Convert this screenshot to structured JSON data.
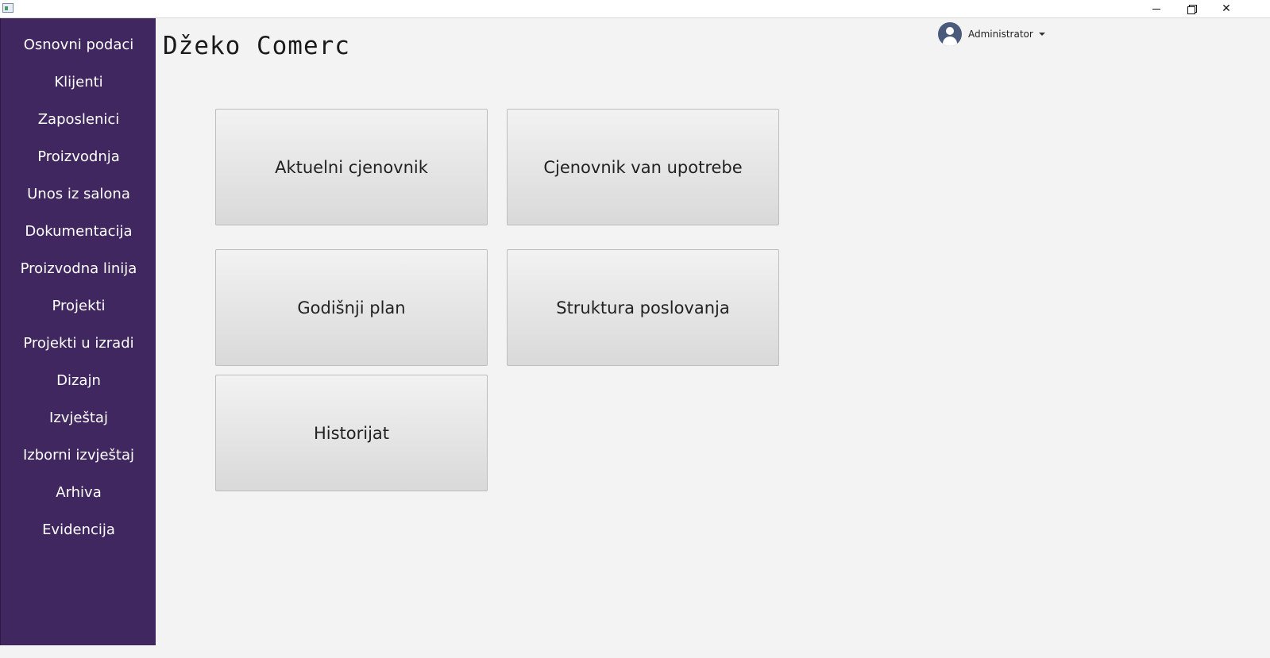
{
  "window": {
    "app_icon": "app-window-icon",
    "minimize_icon": "minimize-icon",
    "maximize_icon": "restore-icon",
    "close_icon": "close-icon",
    "close_glyph": "✕"
  },
  "sidebar": {
    "background": "#41275f",
    "items": [
      {
        "label": "Osnovni podaci"
      },
      {
        "label": "Klijenti"
      },
      {
        "label": "Zaposlenici"
      },
      {
        "label": "Proizvodnja"
      },
      {
        "label": "Unos iz salona"
      },
      {
        "label": "Dokumentacija"
      },
      {
        "label": "Proizvodna linija"
      },
      {
        "label": "Projekti"
      },
      {
        "label": "Projekti u izradi"
      },
      {
        "label": "Dizajn"
      },
      {
        "label": "Izvještaj"
      },
      {
        "label": "Izborni izvještaj"
      },
      {
        "label": "Arhiva"
      },
      {
        "label": "Evidencija"
      }
    ]
  },
  "header": {
    "brand": "Džeko Comerc",
    "user": {
      "name": "Administrator",
      "avatar_icon": "user-avatar-icon",
      "dropdown_icon": "caret-down-icon"
    }
  },
  "tiles": [
    {
      "label": "Aktuelni cjenovnik"
    },
    {
      "label": "Cjenovnik van upotrebe"
    },
    {
      "label": "Godišnji plan"
    },
    {
      "label": "Struktura poslovanja"
    },
    {
      "label": "Historijat"
    }
  ]
}
